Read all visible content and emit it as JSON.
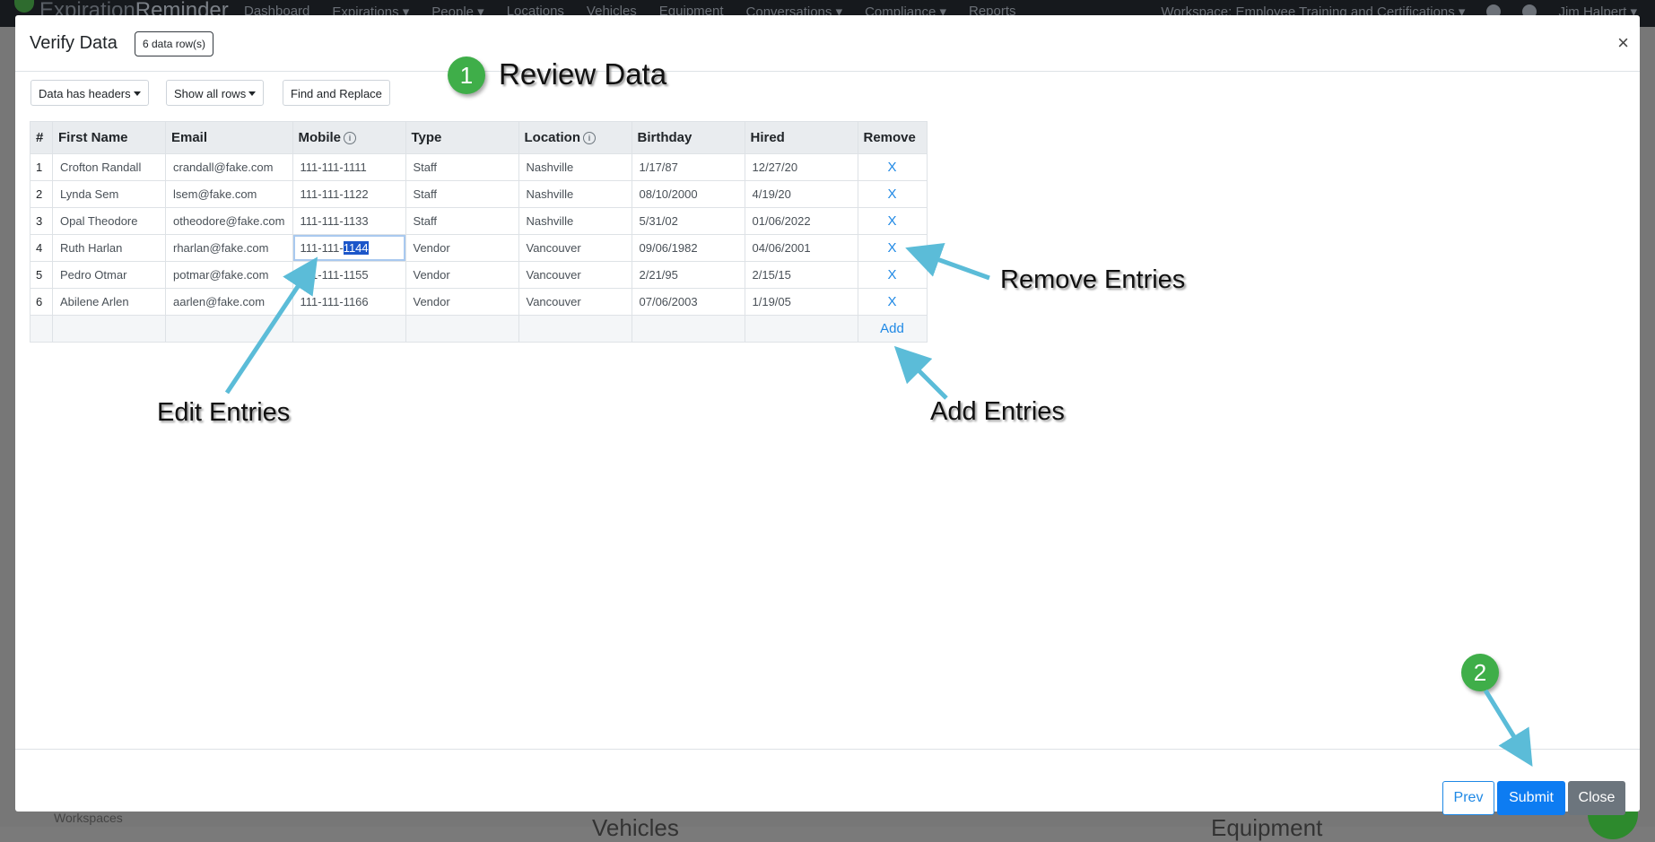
{
  "background": {
    "brand": {
      "part1": "Expiration",
      "part2": "Reminder"
    },
    "nav": [
      "Dashboard",
      "Expirations ▾",
      "People ▾",
      "Locations",
      "Vehicles",
      "Equipment",
      "Conversations ▾",
      "Compliance ▾",
      "Reports"
    ],
    "workspace": "Workspace: Employee Training and Certifications ▾",
    "user": "Jim Halpert ▾",
    "sidebar_label": "Workspaces",
    "section_vehicles": "Vehicles",
    "section_equipment": "Equipment"
  },
  "modal": {
    "title": "Verify Data",
    "rows_badge": "6 data row(s)",
    "close_symbol": "×",
    "toolbar": {
      "headers_label": "Data has headers",
      "rows_label": "Show all rows",
      "find_replace_label": "Find and Replace"
    },
    "table": {
      "columns": [
        "#",
        "First Name",
        "Email",
        "Mobile",
        "Type",
        "Location",
        "Birthday",
        "Hired",
        "Remove"
      ],
      "rows": [
        {
          "num": "1",
          "first_name": "Crofton Randall",
          "email": "crandall@fake.com",
          "mobile": "111-111-1111",
          "type": "Staff",
          "location": "Nashville",
          "birthday": "1/17/87",
          "hired": "12/27/20",
          "remove": "X"
        },
        {
          "num": "2",
          "first_name": "Lynda Sem",
          "email": "lsem@fake.com",
          "mobile": "111-111-1122",
          "type": "Staff",
          "location": "Nashville",
          "birthday": "08/10/2000",
          "hired": "4/19/20",
          "remove": "X"
        },
        {
          "num": "3",
          "first_name": "Opal Theodore",
          "email": "otheodore@fake.com",
          "mobile": "111-111-1133",
          "type": "Staff",
          "location": "Nashville",
          "birthday": "5/31/02",
          "hired": "01/06/2022",
          "remove": "X"
        },
        {
          "num": "4",
          "first_name": "Ruth Harlan",
          "email": "rharlan@fake.com",
          "mobile_prefix": "111-111-",
          "mobile_selected": "1144",
          "type": "Vendor",
          "location": "Vancouver",
          "birthday": "09/06/1982",
          "hired": "04/06/2001",
          "remove": "X"
        },
        {
          "num": "5",
          "first_name": "Pedro Otmar",
          "email": "potmar@fake.com",
          "mobile": "111-111-1155",
          "type": "Vendor",
          "location": "Vancouver",
          "birthday": "2/21/95",
          "hired": "2/15/15",
          "remove": "X"
        },
        {
          "num": "6",
          "first_name": "Abilene Arlen",
          "email": "aarlen@fake.com",
          "mobile": "111-111-1166",
          "type": "Vendor",
          "location": "Vancouver",
          "birthday": "07/06/2003",
          "hired": "1/19/05",
          "remove": "X"
        }
      ],
      "add_label": "Add"
    },
    "footer": {
      "prev": "Prev",
      "submit": "Submit",
      "close": "Close"
    }
  },
  "annotations": {
    "step1": "1",
    "step1_label": "Review Data",
    "step2": "2",
    "remove_entries": "Remove Entries",
    "edit_entries": "Edit Entries",
    "add_entries": "Add Entries",
    "arrow_color": "#5bbcd8",
    "step_color": "#3fae49"
  }
}
